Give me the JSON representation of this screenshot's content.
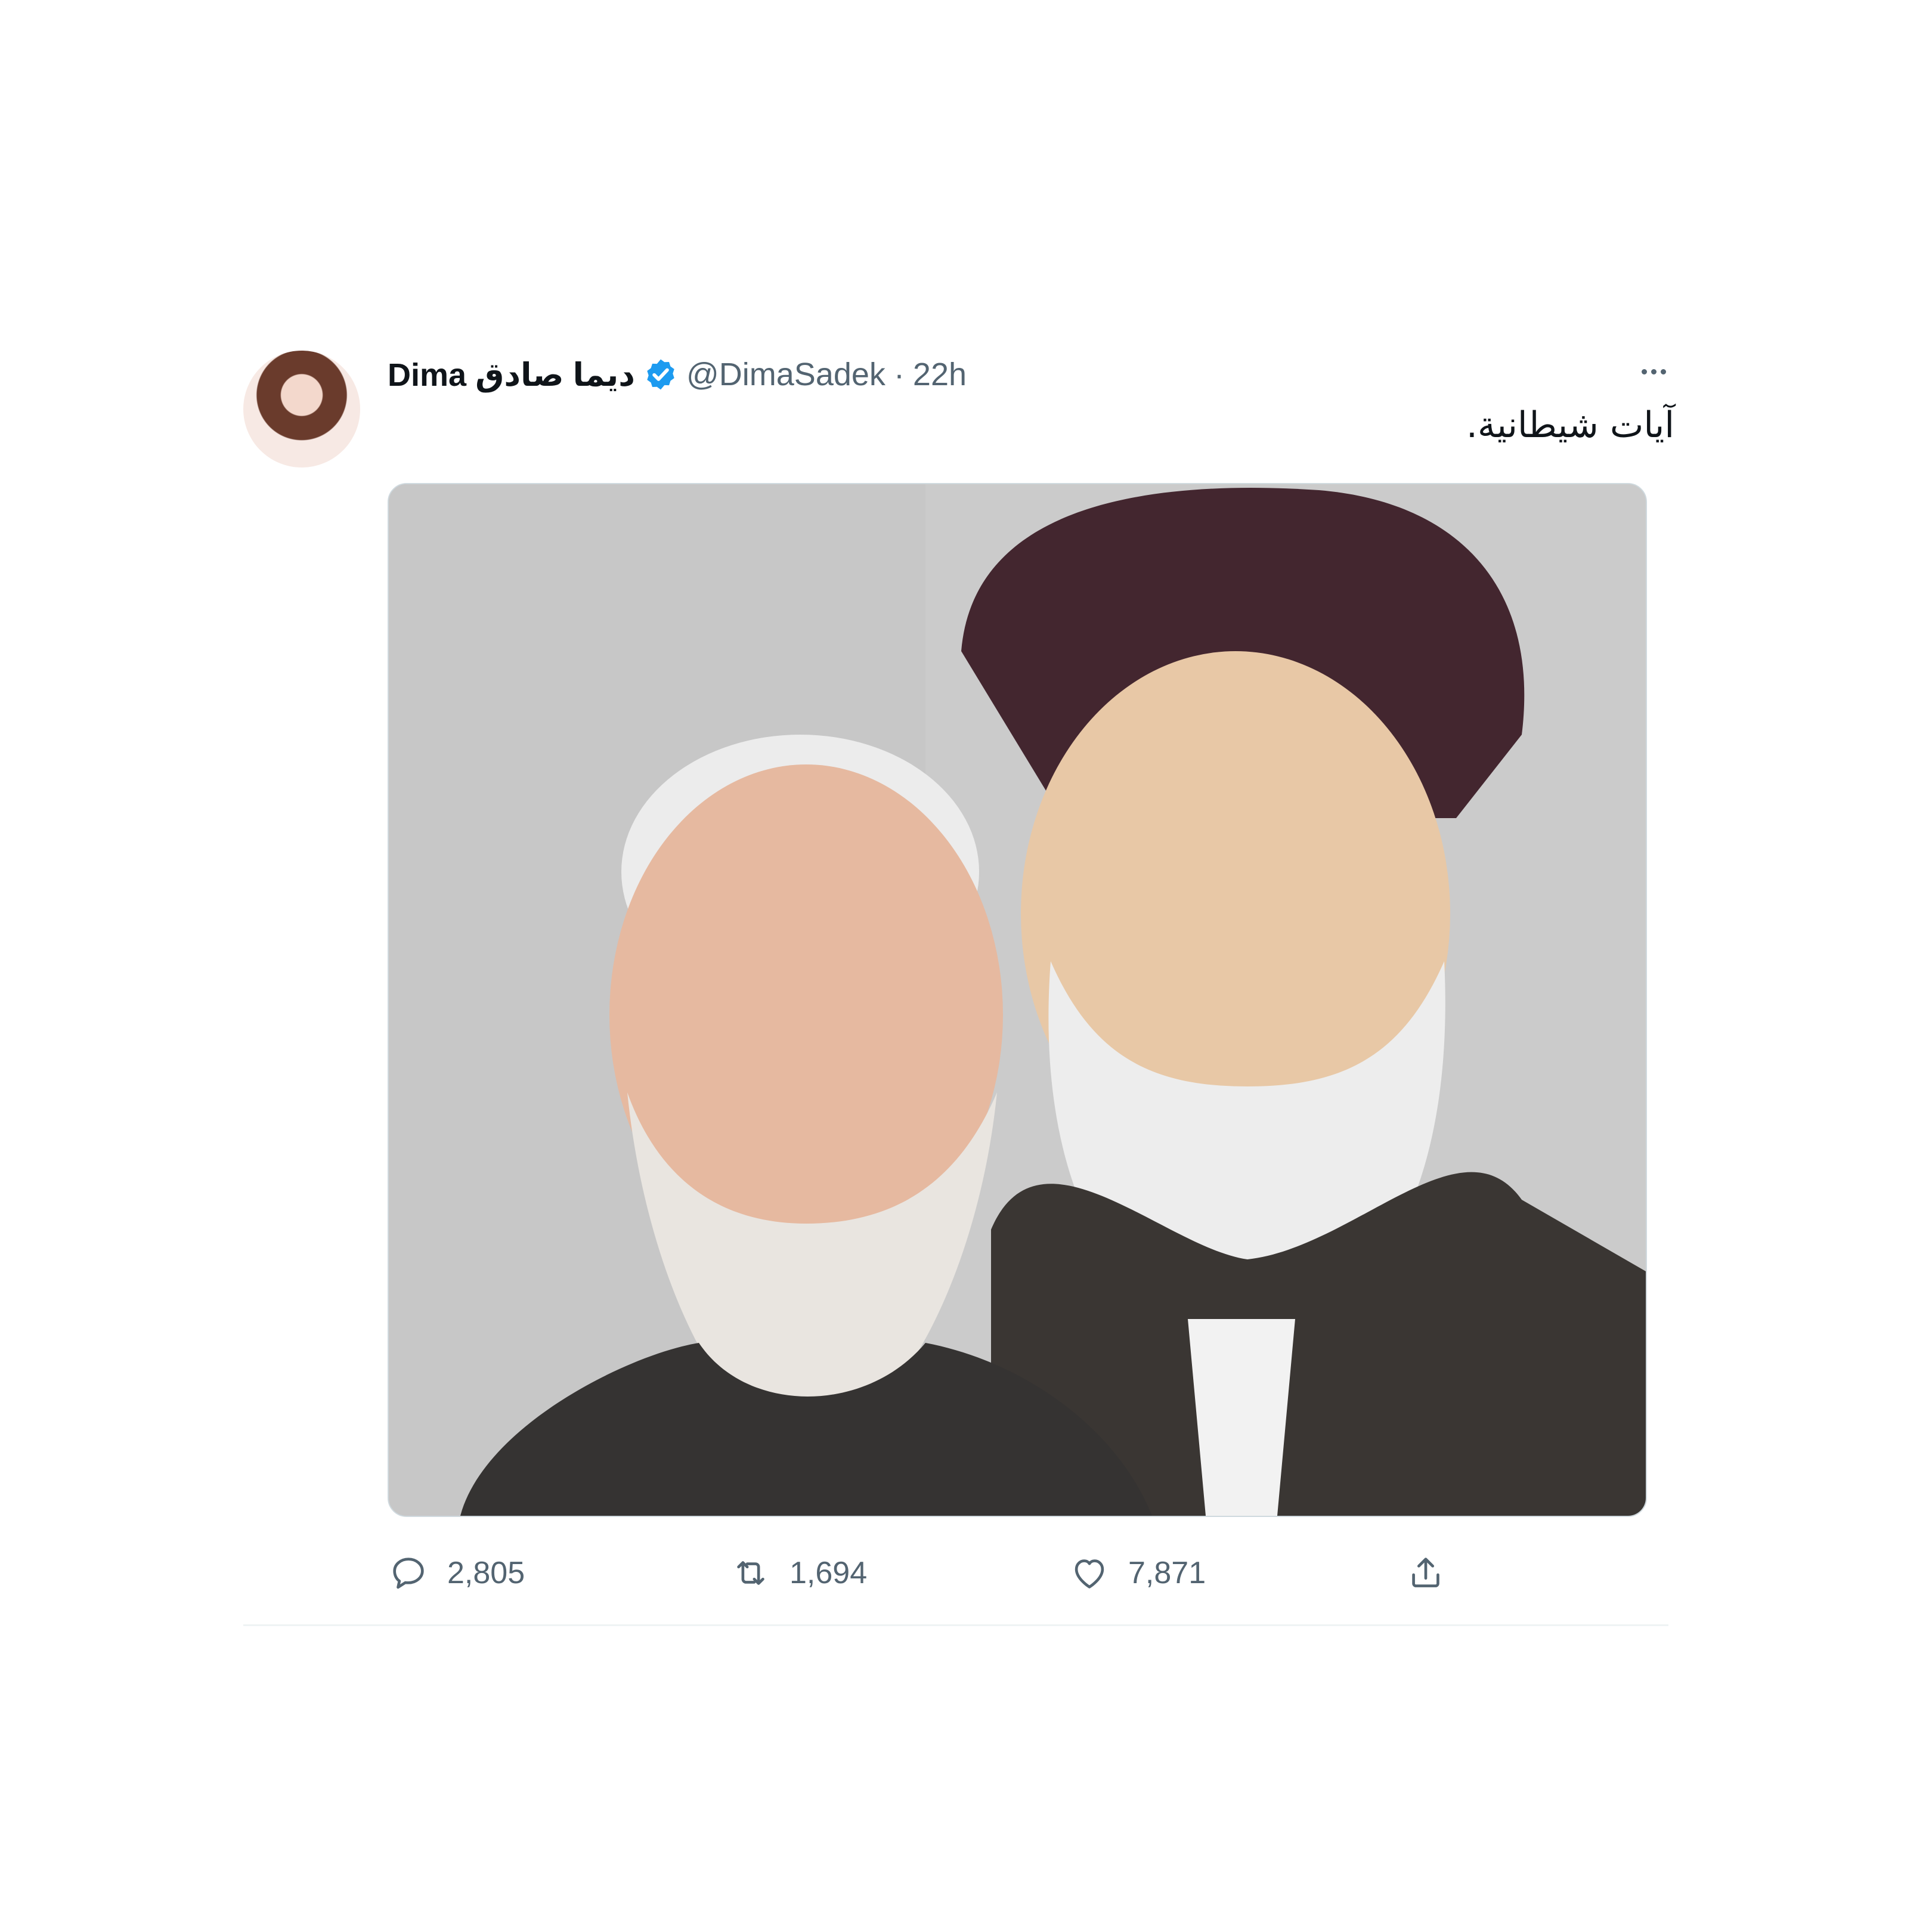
{
  "tweet": {
    "display_name": "Dima ديما صادق",
    "handle": "@DimaSadek",
    "separator": "·",
    "time": "22h",
    "text": "آيات شيطانية."
  },
  "actions": {
    "reply_count": "2,805",
    "retweet_count": "1,694",
    "like_count": "7,871"
  },
  "colors": {
    "verified": "#1d9bf0",
    "secondary_text": "#536471"
  }
}
